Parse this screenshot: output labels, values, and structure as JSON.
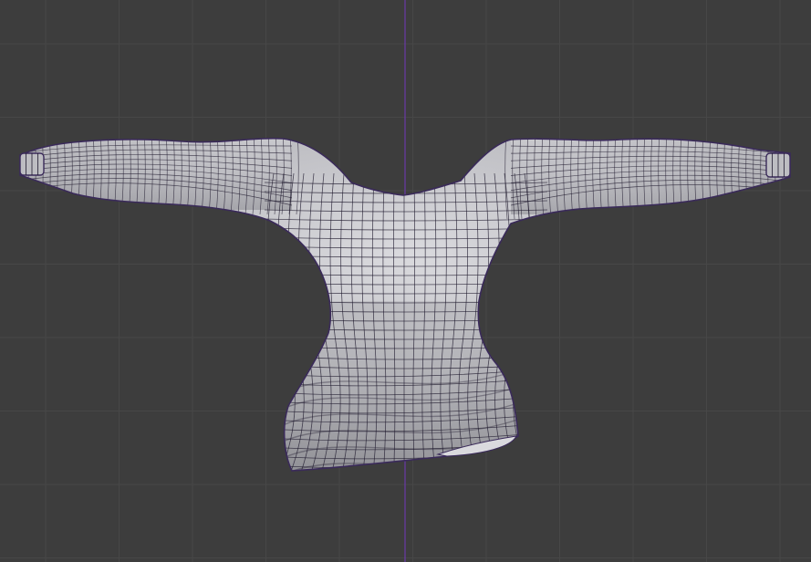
{
  "viewport": {
    "background_color": "#3d3d3d",
    "grid_color": "#474747",
    "axis_color": "#6a3aa8",
    "axis_shown": "vertical",
    "object": {
      "type": "sweater-mesh",
      "display_mode": "wireframe-over-solid",
      "base_color": "#bdbdc2",
      "shade_color": "#8e8e94",
      "highlight_color": "#dadade",
      "wire_color": "#1f1a2e",
      "edge_color": "#3a2a5a"
    }
  }
}
